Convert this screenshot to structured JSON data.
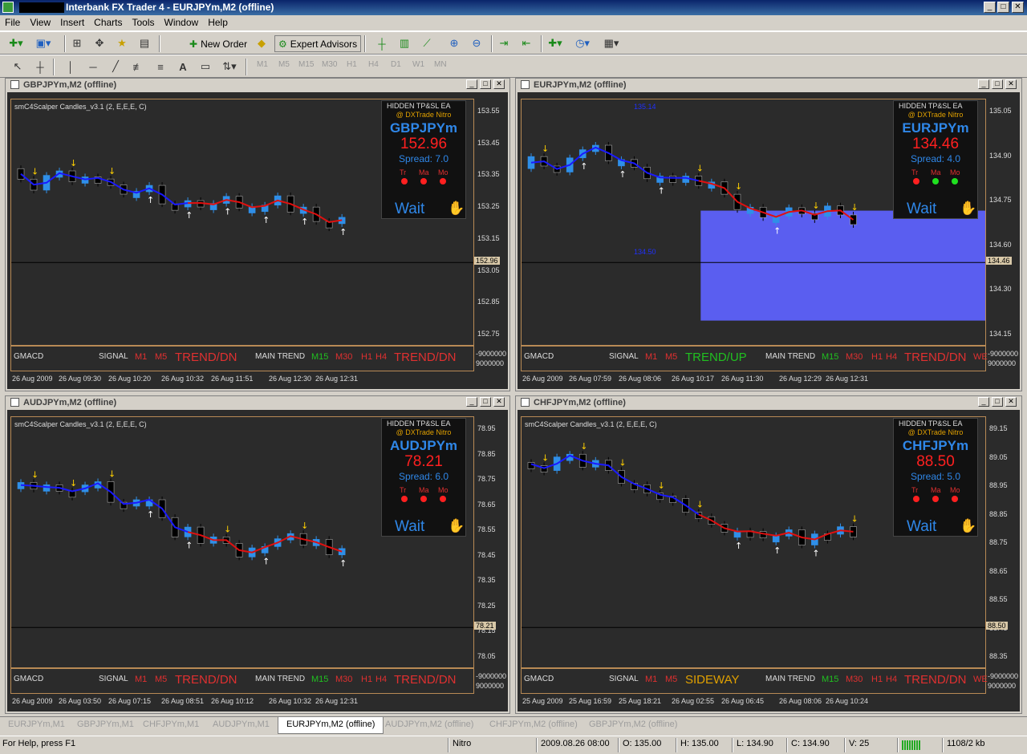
{
  "app": {
    "title": "Interbank FX Trader 4 - EURJPYm,M2 (offline)"
  },
  "menu": [
    "File",
    "View",
    "Insert",
    "Charts",
    "Tools",
    "Window",
    "Help"
  ],
  "toolbar": {
    "new_order": "New Order",
    "expert_advisors": "Expert Advisors",
    "timeframes": [
      "M1",
      "M5",
      "M15",
      "M30",
      "H1",
      "H4",
      "D1",
      "W1",
      "MN"
    ]
  },
  "footer_labels": {
    "gmacd": "GMACD",
    "signal": "SIGNAL",
    "m1": "M1",
    "m5": "M5",
    "main_trend": "MAIN TREND",
    "m15": "M15",
    "m30": "M30",
    "h1": "H1",
    "h4": "H4"
  },
  "colors": {
    "up": "#2f8fe8",
    "down": "#000000",
    "ma_blue": "#1a1aff",
    "ma_red": "#e01010",
    "grid_border": "#b88a55",
    "trend_dn": "#e03030",
    "trend_up": "#20c020",
    "sideway": "#e0a000"
  },
  "charts": [
    {
      "title": "GBPJPYm,M2 (offline)",
      "indicator": "smC4Scalper Candles_v3.1 (2, E,E,E, C)",
      "panel": {
        "hidden": "HIDDEN TP&SL EA",
        "dxtrade": "@ DXTrade Nitro",
        "symbol": "GBPJPYm",
        "bid": "152.96",
        "spread": "Spread: 7.0",
        "wait": "Wait",
        "tf": [
          "Tr",
          "Ma",
          "Mo"
        ],
        "dots": [
          "#ff2020",
          "#ff2020",
          "#ff2020"
        ]
      },
      "price_axis": [
        "153.55",
        "153.45",
        "153.35",
        "153.25",
        "153.15",
        "153.05",
        "152.85",
        "152.75",
        "-9000000",
        "9000000"
      ],
      "current_price": "152.96",
      "times": [
        "26 Aug 2009",
        "26 Aug 09:30",
        "26 Aug 10:20",
        "26 Aug 10:32",
        "26 Aug 11:51",
        "26 Aug 12:30",
        "26 Aug 12:31"
      ],
      "signal_trend": "TREND/DN",
      "main_trend": "TREND/DN",
      "extra_right": ""
    },
    {
      "title": "EURJPYm,M2 (offline)",
      "indicator": "",
      "panel": {
        "hidden": "HIDDEN TP&SL EA",
        "dxtrade": "@ DXTrade Nitro",
        "symbol": "EURJPYm",
        "bid": "134.46",
        "spread": "Spread: 4.0",
        "wait": "Wait",
        "tf": [
          "Tr",
          "Ma",
          "Mo"
        ],
        "dots": [
          "#ff2020",
          "#20e020",
          "#20e020"
        ]
      },
      "price_axis": [
        "135.05",
        "134.90",
        "134.75",
        "134.60",
        "134.30",
        "134.15",
        "-9000000",
        "9000000"
      ],
      "current_price": "134.46",
      "times": [
        "26 Aug 2009",
        "26 Aug 07:59",
        "26 Aug 08:06",
        "26 Aug 10:17",
        "26 Aug 11:30",
        "26 Aug 12:29",
        "26 Aug 12:31"
      ],
      "signal_trend": "TREND/UP",
      "main_trend": "TREND/DN",
      "extra_right": "WE",
      "annotations": [
        "135.14",
        "134.50"
      ]
    },
    {
      "title": "AUDJPYm,M2 (offline)",
      "indicator": "smC4Scalper Candles_v3.1 (2, E,E,E, C)",
      "panel": {
        "hidden": "HIDDEN TP&SL EA",
        "dxtrade": "@ DXTrade Nitro",
        "symbol": "AUDJPYm",
        "bid": "78.21",
        "spread": "Spread: 6.0",
        "wait": "Wait",
        "tf": [
          "Tr",
          "Ma",
          "Mo"
        ],
        "dots": [
          "#ff2020",
          "#ff2020",
          "#ff2020"
        ]
      },
      "price_axis": [
        "78.95",
        "78.85",
        "78.75",
        "78.65",
        "78.55",
        "78.45",
        "78.35",
        "78.25",
        "78.15",
        "78.05",
        "-9000000",
        "9000000"
      ],
      "current_price": "78.21",
      "times": [
        "26 Aug 2009",
        "26 Aug 03:50",
        "26 Aug 07:15",
        "26 Aug 08:51",
        "26 Aug 10:12",
        "26 Aug 10:32",
        "26 Aug 12:31"
      ],
      "signal_trend": "TREND/DN",
      "main_trend": "TREND/DN",
      "extra_right": ""
    },
    {
      "title": "CHFJPYm,M2 (offline)",
      "indicator": "smC4Scalper Candles_v3.1 (2, E,E,E, C)",
      "panel": {
        "hidden": "HIDDEN TP&SL EA",
        "dxtrade": "@ DXTrade Nitro",
        "symbol": "CHFJPYm",
        "bid": "88.50",
        "spread": "Spread: 5.0",
        "wait": "Wait",
        "tf": [
          "Tr",
          "Ma",
          "Mo"
        ],
        "dots": [
          "#ff2020",
          "#ff2020",
          "#ff2020"
        ]
      },
      "price_axis": [
        "89.15",
        "89.05",
        "88.95",
        "88.85",
        "88.75",
        "88.65",
        "88.55",
        "88.45",
        "88.35",
        "-9000000",
        "9000000"
      ],
      "current_price": "88.50",
      "times": [
        "25 Aug 2009",
        "25 Aug 16:59",
        "25 Aug 18:21",
        "26 Aug 02:55",
        "26 Aug 06:45",
        "26 Aug 08:06",
        "26 Aug 10:24"
      ],
      "signal_trend": "SIDEWAY",
      "main_trend": "TREND/DN",
      "extra_right": "WE"
    }
  ],
  "tabs": [
    "EURJPYm,M1",
    "GBPJPYm,M1",
    "CHFJPYm,M1",
    "AUDJPYm,M1",
    "EURJPYm,M2 (offline)",
    "AUDJPYm,M2 (offline)",
    "CHFJPYm,M2 (offline)",
    "GBPJPYm,M2 (offline)"
  ],
  "active_tab": "EURJPYm,M2 (offline)",
  "status": {
    "help": "For Help, press F1",
    "profile": "Nitro",
    "time": "2009.08.26 08:00",
    "open": "O: 135.00",
    "high": "H: 135.00",
    "low": "L: 134.90",
    "close": "C: 134.90",
    "volume": "V: 25",
    "traffic": "1108/2 kb"
  }
}
